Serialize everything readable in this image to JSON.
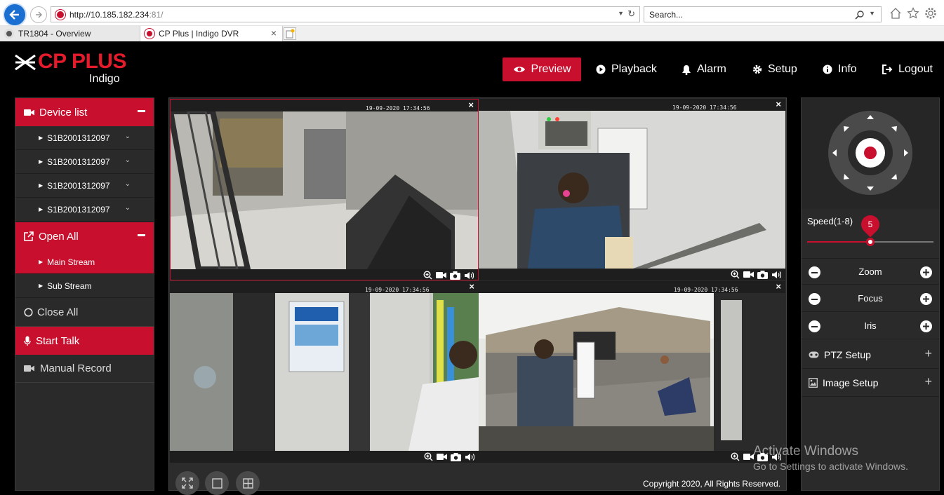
{
  "browser": {
    "url_prefix": "http://10.185.182.234",
    "url_port": ":81/",
    "search_placeholder": "Search...",
    "tabs": [
      {
        "label": "TR1804 - Overview"
      },
      {
        "label": "CP Plus | Indigo DVR",
        "close": "×"
      }
    ]
  },
  "app": {
    "brand": "CP PLUS",
    "subbrand": "Indigo",
    "accent": "#c8102e",
    "nav": [
      {
        "label": "Preview",
        "icon": "eye-icon",
        "active": true
      },
      {
        "label": "Playback",
        "icon": "play-circle-icon"
      },
      {
        "label": "Alarm",
        "icon": "bell-icon"
      },
      {
        "label": "Setup",
        "icon": "gear-icon"
      },
      {
        "label": "Info",
        "icon": "info-icon"
      },
      {
        "label": "Logout",
        "icon": "logout-icon"
      }
    ]
  },
  "sidebar": {
    "device_list_label": "Device list",
    "devices": [
      "S1B2001312097",
      "S1B2001312097",
      "S1B2001312097",
      "S1B2001312097"
    ],
    "open_all_label": "Open All",
    "main_stream_label": "Main Stream",
    "sub_stream_label": "Sub Stream",
    "close_all_label": "Close All",
    "start_talk_label": "Start Talk",
    "manual_record_label": "Manual Record"
  },
  "cameras": [
    {
      "timestamp": "19-09-2020  17:34:56",
      "close": "×"
    },
    {
      "timestamp": "19-09-2020  17:34:56",
      "close": "×"
    },
    {
      "timestamp": "19-09-2020  17:34:56",
      "close": "×"
    },
    {
      "timestamp": "19-09-2020  17:34:56",
      "close": "×"
    }
  ],
  "footer": {
    "copyright": "Copyright 2020, All Rights Reserved."
  },
  "ptz": {
    "speed_label": "Speed(1-8)",
    "speed_value": "5",
    "speed_fraction": 0.5,
    "zoom_label": "Zoom",
    "focus_label": "Focus",
    "iris_label": "Iris",
    "ptz_setup_label": "PTZ Setup",
    "image_setup_label": "Image Setup"
  },
  "watermark": {
    "title": "Activate Windows",
    "subtitle": "Go to Settings to activate Windows."
  }
}
